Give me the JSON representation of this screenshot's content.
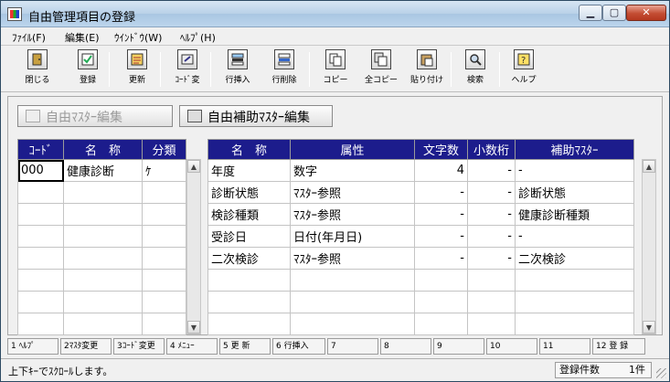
{
  "window": {
    "title": "自由管理項目の登録"
  },
  "menu": [
    "ﾌｧｲﾙ(F)",
    "編集(E)",
    "ｳｲﾝﾄﾞｳ(W)",
    "ﾍﾙﾌﾟ(H)"
  ],
  "toolbar": [
    {
      "label": "閉じる",
      "icon": "close-door-icon"
    },
    {
      "label": "登録",
      "icon": "register-icon"
    },
    {
      "label": "更新",
      "icon": "update-icon"
    },
    {
      "label": "ｺｰﾄﾞ変",
      "icon": "code-change-icon"
    },
    {
      "label": "行挿入",
      "icon": "insert-row-icon"
    },
    {
      "label": "行削除",
      "icon": "delete-row-icon"
    },
    {
      "label": "コピー",
      "icon": "copy-icon"
    },
    {
      "label": "全コピー",
      "icon": "copy-all-icon"
    },
    {
      "label": "貼り付け",
      "icon": "paste-icon"
    },
    {
      "label": "検索",
      "icon": "search-icon"
    },
    {
      "label": "ヘルプ",
      "icon": "help-icon"
    }
  ],
  "buttons": {
    "master_edit": "自由ﾏｽﾀｰ編集",
    "sub_master_edit": "自由補助ﾏｽﾀｰ編集"
  },
  "left_table": {
    "headers": [
      "ｺｰﾄﾞ",
      "名　称",
      "分類"
    ],
    "rows": [
      [
        "000",
        "健康診断",
        "ｹ"
      ]
    ]
  },
  "right_table": {
    "headers": [
      "名　称",
      "属性",
      "文字数",
      "小数桁",
      "補助ﾏｽﾀｰ"
    ],
    "rows": [
      [
        "年度",
        "数字",
        "4",
        "-",
        "-"
      ],
      [
        "診断状態",
        "ﾏｽﾀｰ参照",
        "-",
        "-",
        "診断状態"
      ],
      [
        "検診種類",
        "ﾏｽﾀｰ参照",
        "-",
        "-",
        "健康診断種類"
      ],
      [
        "受診日",
        "日付(年月日)",
        "-",
        "-",
        "-"
      ],
      [
        "二次検診",
        "ﾏｽﾀｰ参照",
        "-",
        "-",
        "二次検診"
      ]
    ]
  },
  "fkeys": [
    "1  ﾍﾙﾌﾟ",
    "2ﾏｽﾀ変更",
    "3ｺｰﾄﾞ変更",
    "4  ﾒﾆｭｰ",
    "5  更 新",
    "6 行挿入",
    "7",
    "8",
    "9",
    "10",
    "11",
    "12  登 録"
  ],
  "status": {
    "text": "上下ｷｰでｽｸﾛｰﾙします。",
    "count_label": "登録件数",
    "count_value": "1件"
  }
}
